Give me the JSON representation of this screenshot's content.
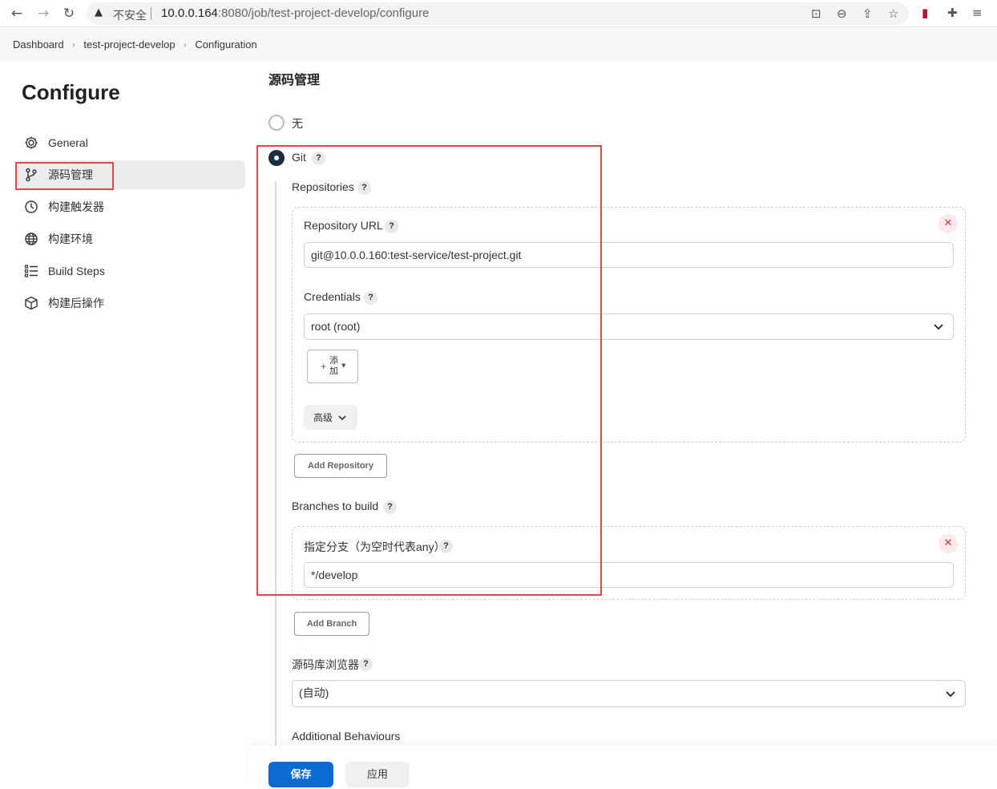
{
  "browser": {
    "insecure_label": "不安全",
    "url_host": "10.0.0.164",
    "url_path": ":8080/job/test-project-develop/configure"
  },
  "breadcrumb": [
    "Dashboard",
    "test-project-develop",
    "Configuration"
  ],
  "sidebar": {
    "title": "Configure",
    "items": [
      {
        "label": "General",
        "icon": "gear-icon"
      },
      {
        "label": "源码管理",
        "icon": "branch-icon"
      },
      {
        "label": "构建触发器",
        "icon": "clock-icon"
      },
      {
        "label": "构建环境",
        "icon": "globe-icon"
      },
      {
        "label": "Build Steps",
        "icon": "list-icon"
      },
      {
        "label": "构建后操作",
        "icon": "box-icon"
      }
    ]
  },
  "scm": {
    "section_title": "源码管理",
    "option_none": "无",
    "option_git": "Git",
    "help_mark": "?",
    "repositories_label": "Repositories",
    "repo_url_label": "Repository URL",
    "repo_url_value": "git@10.0.0.160:test-service/test-project.git",
    "credentials_label": "Credentials",
    "credentials_value": "root (root)",
    "add_label": "添加",
    "advanced_label": "高级",
    "add_repository": "Add Repository",
    "branches_label": "Branches to build",
    "branch_specifier_label": "指定分支（为空时代表any）",
    "branch_value": "*/develop",
    "add_branch": "Add Branch",
    "browser_label": "源码库浏览器",
    "browser_value": "(自动)",
    "additional_behaviours": "Additional Behaviours"
  },
  "footer": {
    "save": "保存",
    "apply": "应用"
  },
  "colors": {
    "primary": "#0b6bd3",
    "highlight": "#e04848",
    "radio_checked": "#1e2c43"
  }
}
